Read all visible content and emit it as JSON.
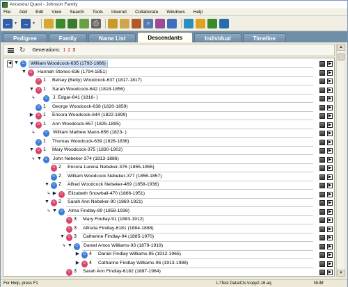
{
  "window": {
    "title": "Ancestral Quest - Johnson Family"
  },
  "menu": [
    "File",
    "Add",
    "Edit",
    "View",
    "Search",
    "Tools",
    "Internet",
    "Collaborate",
    "Windows",
    "Help"
  ],
  "toolbar": {
    "buttons": [
      {
        "icon": "back-arrow-icon",
        "color": "#2f5fa8"
      },
      {
        "icon": "forward-arrow-icon",
        "color": "#2f5fa8"
      },
      {
        "icon": "open-folder-icon",
        "color": "#d9a731"
      },
      {
        "icon": "new-file-icon",
        "color": "#3b8a2c"
      },
      {
        "icon": "download-icon",
        "color": "#3a7a2c"
      },
      {
        "icon": "family-tree-icon",
        "color": "#6aa044"
      },
      {
        "icon": "print-icon",
        "color": "#666666"
      },
      {
        "icon": "edit-person-icon",
        "color": "#c89a2a"
      },
      {
        "icon": "notes-icon",
        "color": "#cfa64b"
      },
      {
        "icon": "sources-icon",
        "color": "#b05a2a"
      },
      {
        "icon": "search-icon",
        "color": "#527bb0"
      },
      {
        "icon": "timeline-icon",
        "color": "#9c4a9c"
      },
      {
        "icon": "scrapbook-icon",
        "color": "#3e6fbf"
      },
      {
        "icon": "reports-icon",
        "color": "#2a8fbf"
      },
      {
        "icon": "charts-icon",
        "color": "#e0a020"
      },
      {
        "icon": "web-icon",
        "color": "#3b8a2c"
      },
      {
        "icon": "ordinances-icon",
        "color": "#2a6aaf"
      }
    ]
  },
  "tabs": [
    {
      "label": "Pedigree",
      "active": false
    },
    {
      "label": "Family",
      "active": false
    },
    {
      "label": "Name List",
      "active": false
    },
    {
      "label": "Descendants",
      "active": true
    },
    {
      "label": "Individual",
      "active": false
    },
    {
      "label": "Timeline",
      "active": false
    }
  ],
  "generations": {
    "label": "Generations:",
    "options": [
      "1",
      "2",
      "3"
    ],
    "selected": "3"
  },
  "tree": [
    {
      "name": "William Woodcock-635 (1792-1866)",
      "indent": 0,
      "gender": "male",
      "gen": "",
      "expander": "▼",
      "selected": true,
      "root": true
    },
    {
      "name": "Hannah Stones-636 (1794-1851)",
      "indent": 1,
      "gender": "female",
      "gen": "",
      "expander": "▼"
    },
    {
      "name": "Betsey (Betty) Woodcock-637 (1817-1817)",
      "indent": 2,
      "gender": "female",
      "gen": "1",
      "expander": ""
    },
    {
      "name": "Sarah Woodcock-642 (1818-1856)",
      "indent": 2,
      "gender": "female",
      "gen": "1",
      "expander": "▼"
    },
    {
      "name": "J. Edgar-641 (1816- )",
      "indent": 3,
      "gender": "male",
      "gen": "",
      "expander": "",
      "mark": "↳"
    },
    {
      "name": "George Woodcock-638 (1820-1859)",
      "indent": 2,
      "gender": "male",
      "gen": "1",
      "expander": ""
    },
    {
      "name": "Encora Woodcock-644 (1822-1899)",
      "indent": 2,
      "gender": "female",
      "gen": "1",
      "expander": "▶"
    },
    {
      "name": "Ann Woodcock-657 (1825-1895)",
      "indent": 2,
      "gender": "female",
      "gen": "1",
      "expander": "▼"
    },
    {
      "name": "William Mathew Mann-656 (1823- )",
      "indent": 3,
      "gender": "male",
      "gen": "",
      "expander": "",
      "mark": "↳"
    },
    {
      "name": "Thomas Woodcock-639 (1828-1836)",
      "indent": 2,
      "gender": "male",
      "gen": "1",
      "expander": ""
    },
    {
      "name": "Mary Woodcock-375 (1830-1902)",
      "indent": 2,
      "gender": "female",
      "gen": "1",
      "expander": "▼"
    },
    {
      "name": "John Nebeker-374 (1813-1886)",
      "indent": 3,
      "gender": "male",
      "gen": "",
      "expander": "▼",
      "mark": "↳"
    },
    {
      "name": "Encora Lurena Nebeker-376 (1855-1855)",
      "indent": 4,
      "gender": "female",
      "gen": "2",
      "expander": ""
    },
    {
      "name": "William Woodcock Nebeker-377 (1856-1857)",
      "indent": 4,
      "gender": "male",
      "gen": "2",
      "expander": ""
    },
    {
      "name": "Alfred Woodcock Nebeker-469 (1858-1936)",
      "indent": 4,
      "gender": "male",
      "gen": "2",
      "expander": "▼"
    },
    {
      "name": "Elizabeth Snowball-470 (1866-1951)",
      "indent": 5,
      "gender": "female",
      "gen": "",
      "expander": "▶",
      "mark": "↳"
    },
    {
      "name": "Sarah Ann Nebeker-90 (1860-1921)",
      "indent": 4,
      "gender": "female",
      "gen": "2",
      "expander": "▼"
    },
    {
      "name": "Alma Findlay-89 (1858-1936)",
      "indent": 5,
      "gender": "male",
      "gen": "",
      "expander": "▼",
      "mark": "↳"
    },
    {
      "name": "Mary Findlay-91 (1883-1912)",
      "indent": 6,
      "gender": "female",
      "gen": "3",
      "expander": ""
    },
    {
      "name": "Alfreda Findlay-6181 (1884-1888)",
      "indent": 6,
      "gender": "female",
      "gen": "3",
      "expander": ""
    },
    {
      "name": "Catherine Findlay-94 (1885-1970)",
      "indent": 6,
      "gender": "female",
      "gen": "3",
      "expander": "▼"
    },
    {
      "name": "Daniel Amos Williams-93 (1879-1919)",
      "indent": 7,
      "gender": "male",
      "gen": "",
      "expander": "▼",
      "mark": "↳"
    },
    {
      "name": "Daniel Findlay Williams-95 (1912-1965)",
      "indent": 8,
      "gender": "male",
      "gen": "4",
      "expander": "▶"
    },
    {
      "name": "Catharine Findlay Williams-96 (1913-1988)",
      "indent": 8,
      "gender": "female",
      "gen": "4",
      "expander": "▶"
    },
    {
      "name": "Sarah Ann Findlay-6182 (1887-1964)",
      "indent": 6,
      "gender": "female",
      "gen": "3",
      "expander": ""
    }
  ],
  "status": {
    "help": "For Help, press F1",
    "path": "L:\\Test Data\\Cls.\\copy2-16.aq",
    "num": "NUM"
  }
}
